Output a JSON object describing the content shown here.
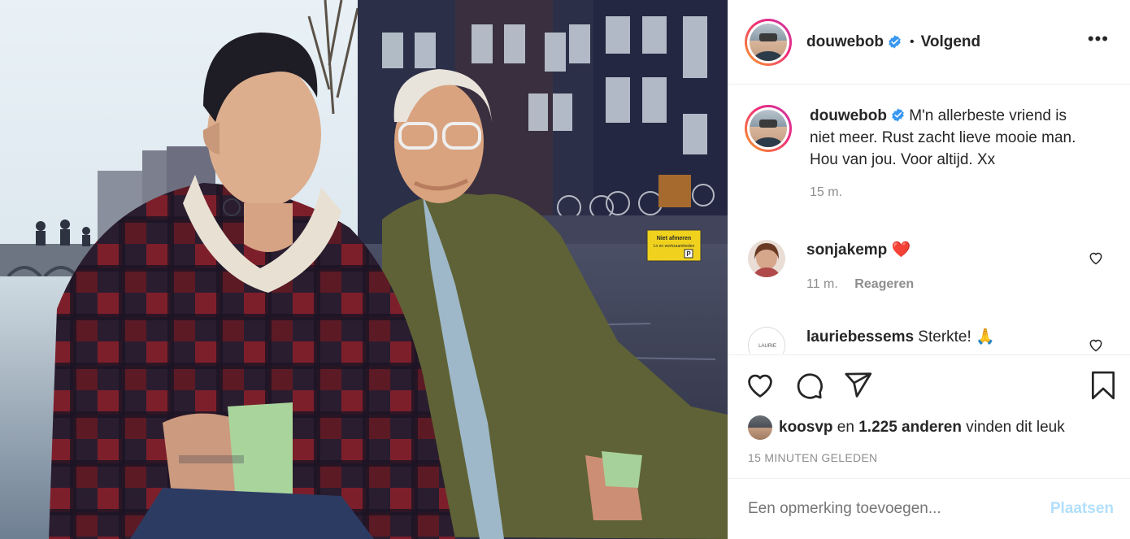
{
  "header": {
    "username": "douwebob",
    "separator": "•",
    "follow_label": "Volgend",
    "more_label": "•••"
  },
  "caption": {
    "username": "douwebob",
    "text": " M'n allerbeste vriend is niet meer. Rust zacht lieve mooie man. Hou van jou. Voor altijd. Xx",
    "time": "15 m."
  },
  "comments": [
    {
      "username": "sonjakemp",
      "text": " ❤️",
      "time": "11 m.",
      "reply_label": "Reageren"
    },
    {
      "username": "lauriebessems",
      "text": " Sterkte! 🙏",
      "avatar_text": "LAURIE"
    }
  ],
  "likes": {
    "user": "koosvp",
    "middle": " en ",
    "count_text": "1.225 anderen",
    "suffix": " vinden dit leuk"
  },
  "timestamp": "15 MINUTEN GELEDEN",
  "add_comment": {
    "placeholder": "Een opmerking toevoegen...",
    "post_label": "Plaatsen"
  },
  "photo": {
    "sign_line1": "Niet afmeren",
    "sign_line2": "Ln en werkzaamheden",
    "sign_letter": "P"
  },
  "colors": {
    "verified": "#3897f0",
    "heart_red": "#ed4956",
    "post_disabled": "#b2dffc",
    "muted": "#8e8e8e"
  },
  "icons": [
    "verified-badge-icon",
    "more-options-icon",
    "heart-icon",
    "comment-icon",
    "share-icon",
    "bookmark-icon"
  ]
}
